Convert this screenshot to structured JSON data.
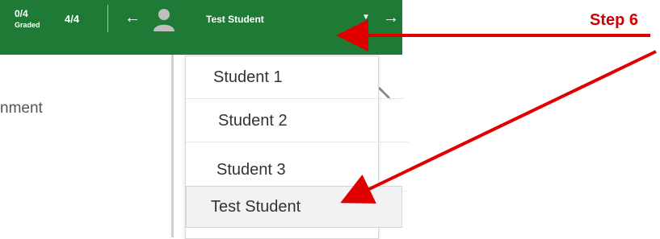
{
  "header": {
    "graded_count": "0/4",
    "graded_label": "Graded",
    "total_count": "4/4",
    "prev_icon": "arrow-left-icon",
    "next_icon": "arrow-right-icon",
    "avatar_icon": "user-avatar-icon",
    "selected_student": "Test Student",
    "caret_icon": "caret-down-icon",
    "background_color": "#1f7a35"
  },
  "left_pane": {
    "title_fragment": "nment"
  },
  "dropdown": {
    "options": [
      {
        "label": "Student 1"
      },
      {
        "label": "Student 2"
      },
      {
        "label": "Student 3"
      },
      {
        "label": "Test Student",
        "highlighted": true
      }
    ]
  },
  "annotation": {
    "step_label": "Step 6",
    "arrow_color": "#e00000"
  }
}
